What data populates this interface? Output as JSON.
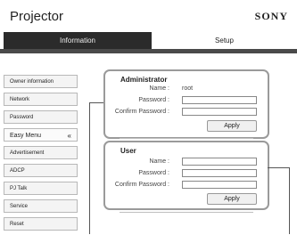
{
  "header": {
    "title": "Projector",
    "brand": "SONY"
  },
  "tabs": [
    {
      "label": "Information"
    },
    {
      "label": "Setup"
    }
  ],
  "sidebar": {
    "items": [
      {
        "label": "Owner information"
      },
      {
        "label": "Network"
      },
      {
        "label": "Password"
      },
      {
        "label": "Easy Menu",
        "chevron": "«"
      },
      {
        "label": "Advertisement"
      },
      {
        "label": "ADCP"
      },
      {
        "label": "PJ Talk"
      },
      {
        "label": "Service"
      },
      {
        "label": "Reset"
      }
    ]
  },
  "administrator": {
    "title": "Administrator",
    "name_label": "Name :",
    "name_value": "root",
    "password_label": "Password :",
    "confirm_label": "Confirm Password :",
    "apply_label": "Apply"
  },
  "user": {
    "title": "User",
    "name_label": "Name :",
    "password_label": "Password :",
    "confirm_label": "Confirm Password :",
    "apply_label": "Apply"
  }
}
